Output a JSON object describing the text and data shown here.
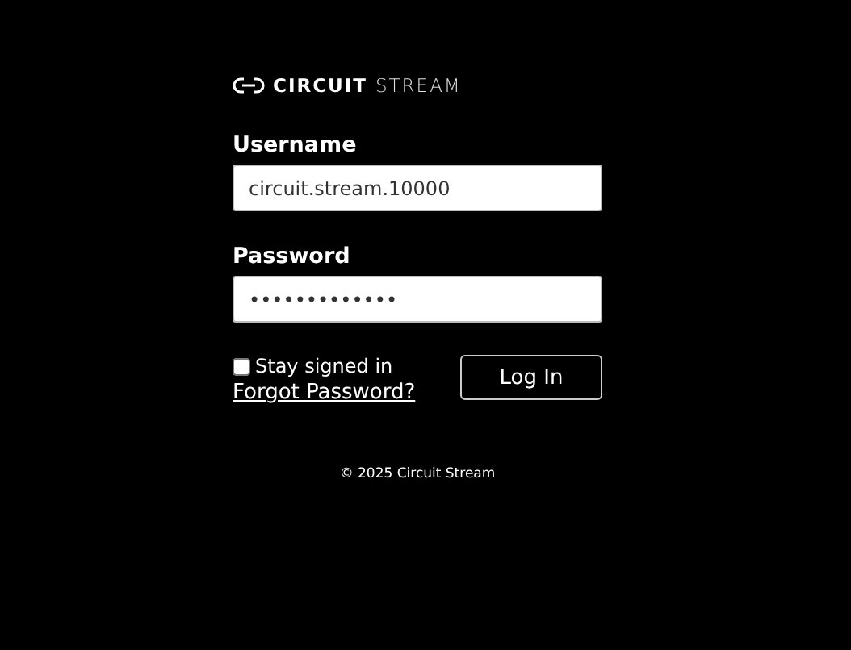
{
  "logo": {
    "bold": "CIRCUIT",
    "light": "STREAM"
  },
  "fields": [
    {
      "label": "Username",
      "value": "circuit.stream.10000"
    },
    {
      "label": "Password",
      "value": "•••••••••••••"
    }
  ],
  "remember": {
    "label": "Stay signed in",
    "checked": false
  },
  "forgot_link": "Forgot Password?",
  "login_button": "Log In",
  "footer": "© 2025 Circuit Stream"
}
